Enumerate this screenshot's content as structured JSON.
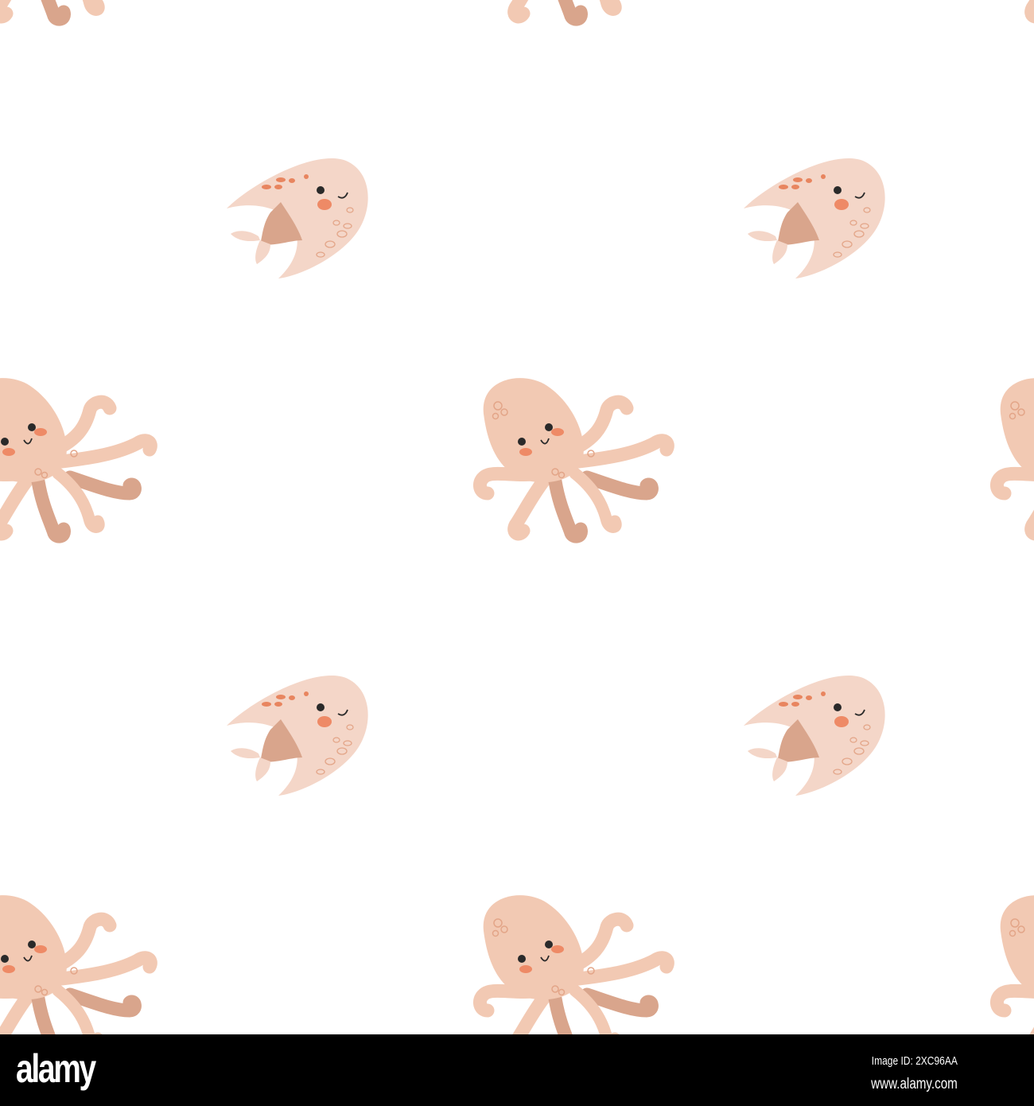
{
  "pattern": {
    "motifs": [
      "octopus",
      "fish"
    ],
    "colors": {
      "body": "#f2c9b3",
      "fish_body": "#f4d6c8",
      "dark": "#d9a58c",
      "cheek": "#ee8a66",
      "spot": "#e8855f",
      "eye": "#2a2a2a"
    }
  },
  "watermark": {
    "logo": "alamy",
    "image_id": "Image ID: 2XC96AA",
    "site": "www.alamy.com"
  }
}
